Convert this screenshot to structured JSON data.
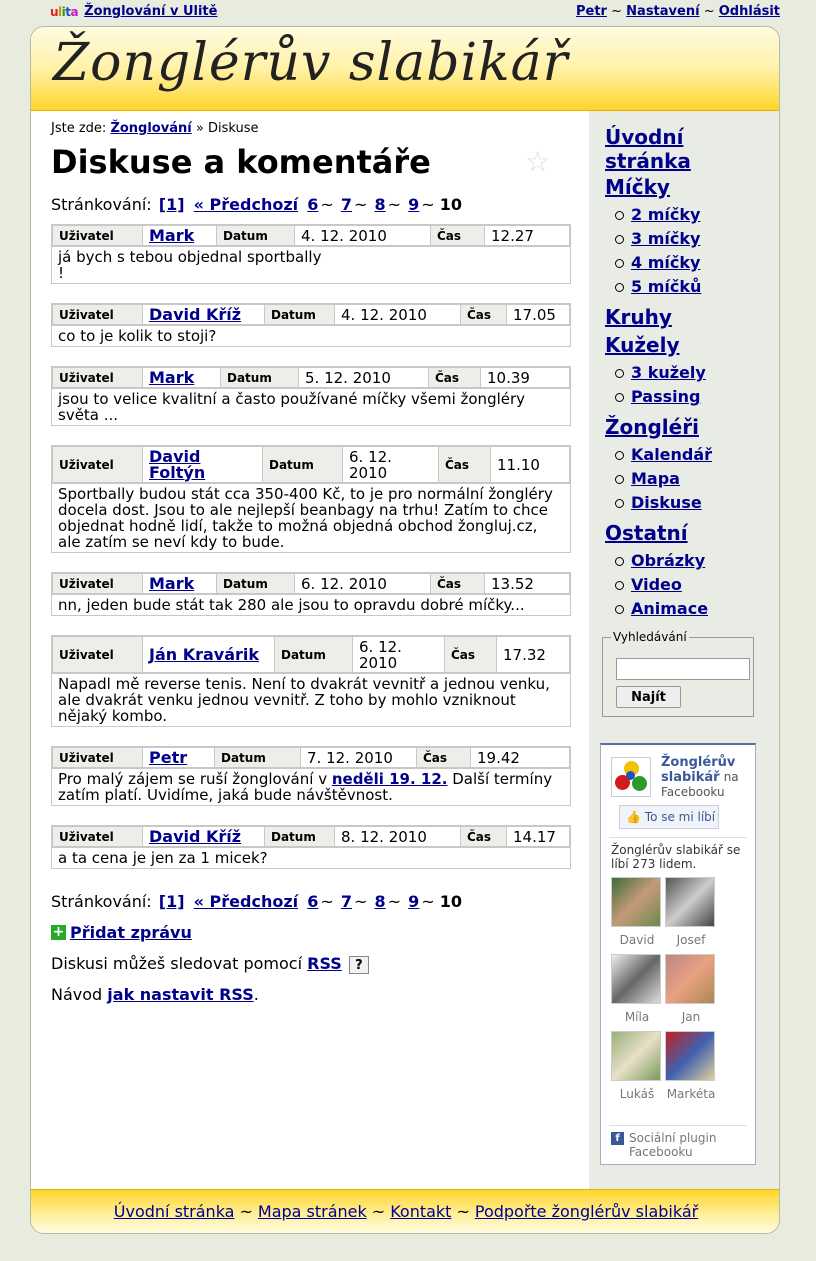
{
  "topbar": {
    "logo": "ulita",
    "site_link": "Žonglování v Ulitě",
    "user_link": "Petr",
    "settings_link": "Nastavení",
    "logout_link": "Odhlásit",
    "sep": "~"
  },
  "header": {
    "title": "Žonglérův slabikář"
  },
  "breadcrumb": {
    "prefix": "Jste zde:",
    "link": "Žonglování",
    "sep": "»",
    "current": "Diskuse"
  },
  "page_title": "Diskuse a komentáře",
  "paging": {
    "label": "Stránkování:",
    "first": "[1]",
    "prev": "« Předchozí",
    "pages": [
      "6",
      "7",
      "8",
      "9"
    ],
    "current": "10",
    "sep": "~"
  },
  "labels": {
    "user": "Uživatel",
    "date": "Datum",
    "time": "Čas"
  },
  "posts": [
    {
      "user": "Mark",
      "date": "4. 12. 2010",
      "time": "12.27",
      "body": "já bych s tebou objednal sportbally\n!"
    },
    {
      "user": "David Kříž",
      "date": "4. 12. 2010",
      "time": "17.05",
      "body": "co to je kolik to stoji?"
    },
    {
      "user": "Mark",
      "date": "5. 12. 2010",
      "time": "10.39",
      "body": "jsou to velice kvalitní a často používané míčky všemi žongléry světa ..."
    },
    {
      "user": "David Foltýn",
      "date": "6. 12. 2010",
      "time": "11.10",
      "body": "Sportbally budou stát cca 350-400 Kč, to je pro normální žongléry docela dost. Jsou to ale nejlepší beanbagy na trhu! Zatím to chce objednat hodně lidí, takže to možná objedná obchod žongluj.cz, ale zatím se neví kdy to bude."
    },
    {
      "user": "Mark",
      "date": "6. 12. 2010",
      "time": "13.52",
      "body": "nn, jeden bude stát tak 280 ale jsou to opravdu dobré míčky..."
    },
    {
      "user": "Ján Kravárik",
      "date": "6. 12. 2010",
      "time": "17.32",
      "body": "Napadl mě reverse tenis. Není to dvakrát vevnitř a jednou venku, ale dvakrát venku jednou vevnitř. Z toho by mohlo vzniknout nějaký kombo."
    },
    {
      "user": "Petr",
      "date": "7. 12. 2010",
      "time": "19.42",
      "body_pre": "Pro malý zájem se ruší žonglování v ",
      "body_link": "neděli 19. 12.",
      "body_post": " Další termíny zatím platí. Uvidíme, jaká bude návštěvnost."
    },
    {
      "user": "David Kříž",
      "date": "8. 12. 2010",
      "time": "14.17",
      "body": "a ta cena je jen za 1 micek?"
    }
  ],
  "add_message": "Přidat zprávu",
  "rss": {
    "text": "Diskusi můžeš sledovat pomocí",
    "link": "RSS",
    "help": "?"
  },
  "rss_howto": {
    "text": "Návod",
    "link": "jak nastavit RSS",
    "end": "."
  },
  "nav": {
    "home": "Úvodní stránka",
    "balls": "Míčky",
    "balls_items": [
      "2 míčky",
      "3 míčky",
      "4 míčky",
      "5 míčků"
    ],
    "rings": "Kruhy",
    "clubs": "Kužely",
    "clubs_items": [
      "3 kužely",
      "Passing"
    ],
    "jugglers": "Žongléři",
    "jugglers_items": [
      "Kalendář",
      "Mapa",
      "Diskuse"
    ],
    "other": "Ostatní",
    "other_items": [
      "Obrázky",
      "Video",
      "Animace"
    ]
  },
  "search": {
    "legend": "Vyhledávání",
    "button": "Najít",
    "value": ""
  },
  "facebook": {
    "page_name": "Žonglérův slabikář",
    "suffix": "na Facebooku",
    "like": "To se mi líbí",
    "count": "Žonglérův slabikář se líbí 273 lidem.",
    "fans": [
      "David",
      "Josef",
      "Míla",
      "Jan",
      "Lukáš",
      "Markéta"
    ],
    "plugin": "Sociální plugin Facebooku"
  },
  "footer": {
    "links": [
      "Úvodní stránka",
      "Mapa stránek",
      "Kontakt",
      "Podpořte žonglérův slabikář"
    ],
    "sep": "~"
  },
  "colors": {
    "link": "#00008b",
    "header_yellow": "#ffd52a",
    "sidebar_bg": "#e9ece5",
    "page_bg": "#e8ecdf"
  }
}
